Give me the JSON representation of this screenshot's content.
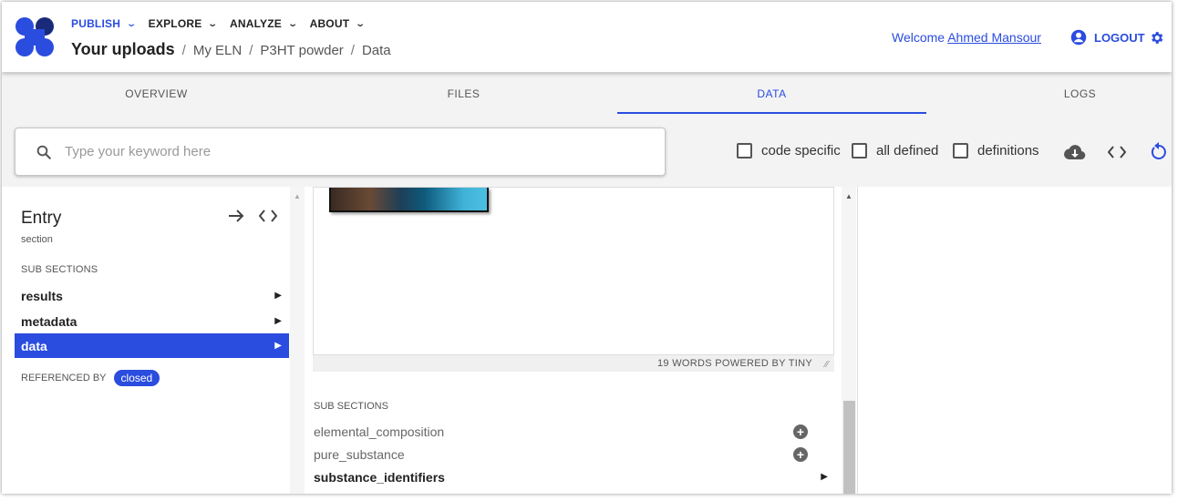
{
  "header": {
    "menu": [
      {
        "label": "PUBLISH",
        "active": true
      },
      {
        "label": "EXPLORE",
        "active": false
      },
      {
        "label": "ANALYZE",
        "active": false
      },
      {
        "label": "ABOUT",
        "active": false
      }
    ],
    "breadcrumb": [
      "Your uploads",
      "My ELN",
      "P3HT powder",
      "Data"
    ],
    "welcome_prefix": "Welcome",
    "user_name": "Ahmed Mansour",
    "logout_label": "LOGOUT",
    "accent_color": "#2a4cdf"
  },
  "tabs": [
    {
      "label": "OVERVIEW"
    },
    {
      "label": "FILES"
    },
    {
      "label": "DATA",
      "active": true
    },
    {
      "label": "LOGS"
    }
  ],
  "toolbar": {
    "search_placeholder": "Type your keyword here",
    "checkboxes": [
      {
        "label": "code specific",
        "checked": false
      },
      {
        "label": "all defined",
        "checked": false
      },
      {
        "label": "definitions",
        "checked": false
      }
    ],
    "icons": [
      "cloud-download-icon",
      "code-icon",
      "reload-icon"
    ]
  },
  "left_pane": {
    "title": "Entry",
    "subtitle": "section",
    "sub_sections_label": "SUB SECTIONS",
    "items": [
      {
        "label": "results",
        "selected": false
      },
      {
        "label": "metadata",
        "selected": false
      },
      {
        "label": "data",
        "selected": true
      }
    ],
    "referenced_by_label": "REFERENCED BY",
    "referenced_chip": "closed"
  },
  "middle_pane": {
    "editor_status": "19 WORDS  POWERED BY TINY",
    "sub_sections_label": "SUB SECTIONS",
    "items": [
      {
        "label": "elemental_composition",
        "action": "plus"
      },
      {
        "label": "pure_substance",
        "action": "plus"
      },
      {
        "label": "substance_identifiers",
        "action": "caret"
      }
    ]
  }
}
